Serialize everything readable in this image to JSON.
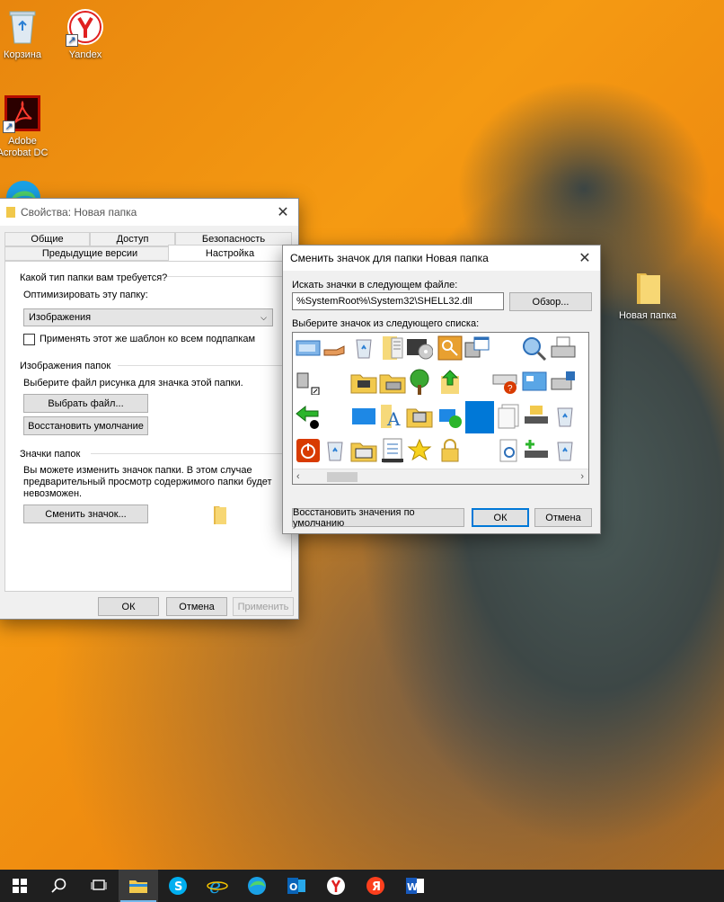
{
  "desktop": {
    "icons": [
      {
        "label": "Корзина"
      },
      {
        "label": "Yandex"
      },
      {
        "label": "Adobe Acrobat DC"
      },
      {
        "label": "Новая папка"
      }
    ]
  },
  "props_window": {
    "title": "Свойства: Новая папка",
    "tabs": {
      "general": "Общие",
      "access": "Доступ",
      "security": "Безопасность",
      "prev_versions": "Предыдущие версии",
      "customize": "Настройка"
    },
    "question": "Какой тип папки вам требуется?",
    "optimize_label": "Оптимизировать эту папку:",
    "optimize_value": "Изображения",
    "apply_template_label": "Применять этот же шаблон ко всем подпапкам",
    "folder_pictures_group": "Изображения папок",
    "choose_file_hint": "Выберите файл рисунка для значка этой папки.",
    "choose_file_button": "Выбрать файл...",
    "restore_default_button": "Восстановить умолчание",
    "folder_icons_group": "Значки папок",
    "icons_note_1": "Вы можете изменить значок папки. В этом случае",
    "icons_note_2": "предварительный просмотр содержимого папки будет",
    "icons_note_3": "невозможен.",
    "change_icon_button": "Сменить значок...",
    "ok": "ОК",
    "cancel": "Отмена",
    "apply": "Применить"
  },
  "change_icon_dialog": {
    "title": "Сменить значок для папки Новая папка",
    "search_label": "Искать значки в следующем файле:",
    "file_path": "%SystemRoot%\\System32\\SHELL32.dll",
    "browse_button": "Обзор...",
    "list_label": "Выберите значок из следующего списка:",
    "restore_defaults_button": "Восстановить значения по умолчанию",
    "ok": "ОК",
    "cancel": "Отмена"
  }
}
